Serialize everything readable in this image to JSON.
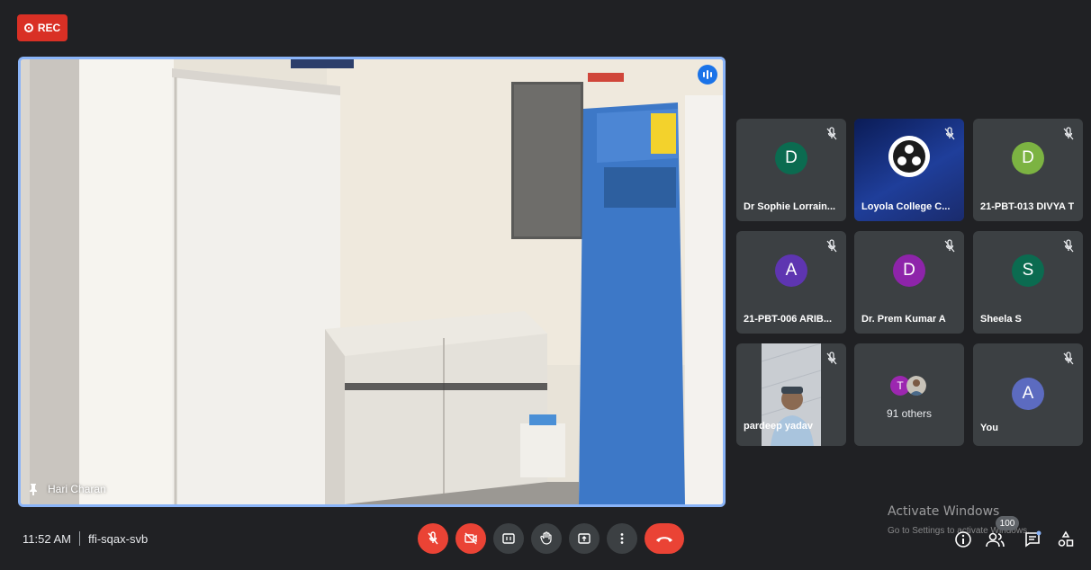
{
  "recording": {
    "label": "REC",
    "color": "#d93025"
  },
  "main_video": {
    "speaker_name": "Hari Charan",
    "pin_icon": "pin-icon",
    "speaking_icon": "speaking-indicator-icon"
  },
  "participants": [
    {
      "name": "Dr Sophie Lorrain...",
      "initial": "D",
      "avatar_color": "#0b6b50",
      "muted": true
    },
    {
      "name": "Loyola College C...",
      "initial": "",
      "avatar_type": "logo",
      "muted": true
    },
    {
      "name": "21-PBT-013 DIVYA T",
      "initial": "D",
      "avatar_color": "#7cb342",
      "muted": true
    },
    {
      "name": "21-PBT-006 ARIB...",
      "initial": "A",
      "avatar_color": "#5e35b1",
      "muted": true
    },
    {
      "name": "Dr. Prem Kumar A",
      "initial": "D",
      "avatar_color": "#8e24aa",
      "muted": true
    },
    {
      "name": "Sheela S",
      "initial": "S",
      "avatar_color": "#0b6b50",
      "muted": true
    },
    {
      "name": "pardeep yadav",
      "avatar_type": "video",
      "muted": true
    },
    {
      "name": "91 others",
      "group_initials": [
        "T"
      ],
      "group_colors": [
        "#9c27b0"
      ]
    },
    {
      "name": "You",
      "initial": "A",
      "avatar_color": "#5c6bc0",
      "muted": true
    }
  ],
  "meeting": {
    "time": "11:52 AM",
    "code": "ffi-sqax-svb"
  },
  "controls": [
    "mic-off-icon",
    "camera-off-icon",
    "captions-icon",
    "raise-hand-icon",
    "present-icon",
    "more-options-icon",
    "end-call-icon"
  ],
  "side_panel": {
    "people_count": "100"
  },
  "watermark": {
    "title": "Activate Windows",
    "subtitle": "Go to Settings to activate Windows."
  },
  "colors": {
    "background": "#202124",
    "tile": "#3c4043",
    "accent": "#8ab4f8",
    "danger": "#ea4335"
  }
}
